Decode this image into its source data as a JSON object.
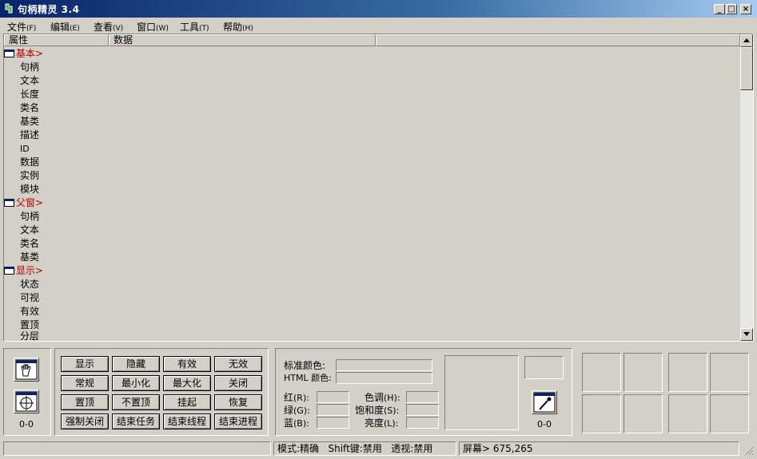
{
  "window": {
    "title": "句柄精灵 3.4",
    "minimize": "_",
    "restore": "□",
    "close": "×"
  },
  "menu": [
    {
      "label": "文件",
      "acc": "(F)"
    },
    {
      "label": "编辑",
      "acc": "(E)"
    },
    {
      "label": "查看",
      "acc": "(V)"
    },
    {
      "label": "窗口",
      "acc": "(W)"
    },
    {
      "label": "工具",
      "acc": "(T)"
    },
    {
      "label": "帮助",
      "acc": "(H)"
    }
  ],
  "list": {
    "headers": [
      "属性",
      "数据"
    ],
    "groups": [
      {
        "label": "基本>",
        "items": [
          "句柄",
          "文本",
          "长度",
          "类名",
          "基类",
          "描述",
          "ID",
          "数据",
          "实例",
          "模块"
        ]
      },
      {
        "label": "父窗>",
        "items": [
          "句柄",
          "文本",
          "类名",
          "基类"
        ]
      },
      {
        "label": "显示>",
        "items": [
          "状态",
          "可视",
          "有效",
          "置顶",
          "分层"
        ]
      }
    ]
  },
  "finder": {
    "counter": "0-0"
  },
  "actions": {
    "rows": [
      [
        "显示",
        "隐藏",
        "有效",
        "无效"
      ],
      [
        "常规",
        "最小化",
        "最大化",
        "关闭"
      ],
      [
        "置顶",
        "不置顶",
        "挂起",
        "恢复"
      ],
      [
        "强制关闭",
        "结束任务",
        "结束线程",
        "结束进程"
      ]
    ]
  },
  "color": {
    "std_label": "标准颜色:",
    "html_label": "HTML 颜色:",
    "red": "红",
    "red_acc": "(R):",
    "green": "绿",
    "green_acc": "(G):",
    "blue": "蓝",
    "blue_acc": "(B):",
    "hue": "色调",
    "hue_acc": "(H):",
    "sat": "饱和度",
    "sat_acc": "(S):",
    "lum": "亮度",
    "lum_acc": "(L):",
    "counter": "0-0"
  },
  "status": {
    "mode": "模式:精确",
    "shift": "Shift键:禁用",
    "transparency": "透视:禁用",
    "screen": "屏幕> 675,265"
  }
}
